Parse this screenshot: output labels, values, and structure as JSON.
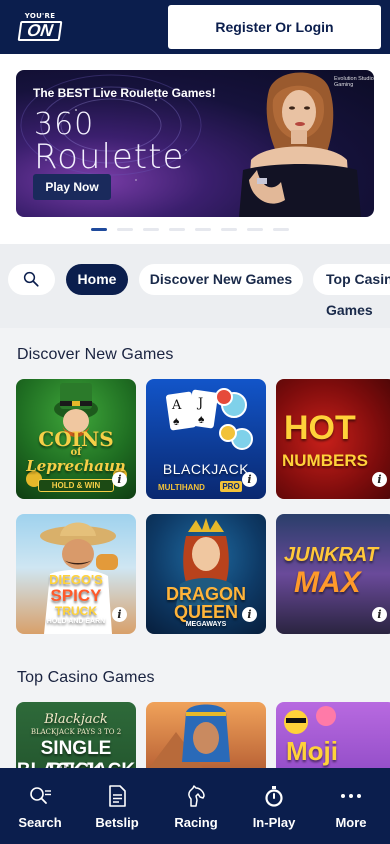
{
  "header": {
    "logo": {
      "top_text": "YOU'RE",
      "main_text": "ON"
    },
    "login_label": "Register Or Login"
  },
  "hero": {
    "tagline": "The BEST Live Roulette Games!",
    "title_line1": "360",
    "title_line2": "Roulette",
    "play_label": "Play Now",
    "brand_text": "Evolution Studio Gaming",
    "slides_count": 8,
    "active_slide": 1
  },
  "chips": {
    "search_icon": "search-icon",
    "home": "Home",
    "discover": "Discover New Games",
    "top": "Top Casino Games"
  },
  "discover": {
    "title": "Discover New Games",
    "games": [
      {
        "name": "Coins of Leprechaun",
        "line1": "COINS",
        "line2": "of",
        "line3": "Leprechaun",
        "badge": "HOLD & WIN"
      },
      {
        "name": "Blackjack Multihand Pro",
        "line1": "BLACKJACK",
        "badge": "MULTIHAND",
        "badge2": "PRO"
      },
      {
        "name": "Hot Numbers",
        "line1": "HOT",
        "line2": "NUMBERS"
      },
      {
        "name": "Diego's Spicy Truck",
        "line1": "DIEGO'S",
        "line2": "SPICY",
        "line3": "TRUCK",
        "badge": "HOLD AND EARN"
      },
      {
        "name": "Dragon Queen Megaways",
        "line1": "DRAGON",
        "line2": "QUEEN",
        "badge": "MEGAWAYS"
      },
      {
        "name": "Junkrat Max",
        "line1": "JUNKRAT",
        "line2": "MAX"
      }
    ]
  },
  "top_casino": {
    "title": "Top Casino Games",
    "games": [
      {
        "name": "Single Deck Blackjack",
        "line1": "Blackjack",
        "line2": "BLACKJACK PAYS 3 TO 2",
        "line3": "SINGLE DECK",
        "line4": "BLACKJACK"
      },
      {
        "name": "Egyptian slot",
        "line1": ""
      },
      {
        "name": "Moji",
        "line1": "Moji"
      }
    ]
  },
  "bottom_nav": [
    {
      "label": "Search",
      "icon": "search-icon"
    },
    {
      "label": "Betslip",
      "icon": "betslip-icon"
    },
    {
      "label": "Racing",
      "icon": "horse-icon"
    },
    {
      "label": "In-Play",
      "icon": "stopwatch-icon"
    },
    {
      "label": "More",
      "icon": "more-dots-icon"
    }
  ],
  "colors": {
    "navy": "#0b1e4d",
    "accent": "#1f4a9c"
  }
}
